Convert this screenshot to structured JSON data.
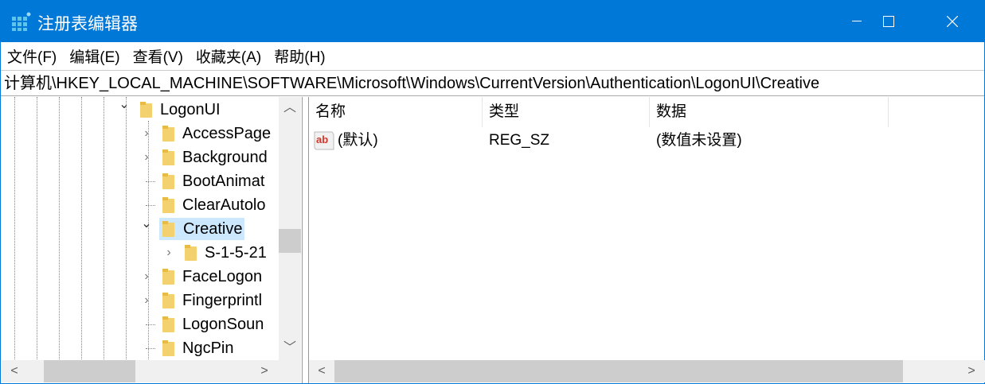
{
  "window": {
    "title": "注册表编辑器",
    "accent": "#0078d7"
  },
  "menu": [
    "文件(F)",
    "编辑(E)",
    "查看(V)",
    "收藏夹(A)",
    "帮助(H)"
  ],
  "address": "计算机\\HKEY_LOCAL_MACHINE\\SOFTWARE\\Microsoft\\Windows\\CurrentVersion\\Authentication\\LogonUI\\Creative",
  "tree": [
    {
      "label": "LogonUI",
      "expander": "expanded",
      "level": 0
    },
    {
      "label": "AccessPage",
      "expander": "collapsed",
      "level": 1
    },
    {
      "label": "Background",
      "expander": "collapsed",
      "level": 1
    },
    {
      "label": "BootAnimat",
      "expander": "none",
      "level": 1
    },
    {
      "label": "ClearAutolo",
      "expander": "none",
      "level": 1
    },
    {
      "label": "Creative",
      "expander": "expanded",
      "level": 1,
      "selected": true
    },
    {
      "label": "S-1-5-21",
      "expander": "collapsed",
      "level": 2
    },
    {
      "label": "FaceLogon",
      "expander": "collapsed",
      "level": 1
    },
    {
      "label": "Fingerprintl",
      "expander": "collapsed",
      "level": 1
    },
    {
      "label": "LogonSoun",
      "expander": "none",
      "level": 1
    },
    {
      "label": "NgcPin",
      "expander": "none",
      "level": 1
    }
  ],
  "values": {
    "columns": [
      "名称",
      "类型",
      "数据"
    ],
    "rows": [
      {
        "name": "(默认)",
        "type": "REG_SZ",
        "data": "(数值未设置)",
        "icon": "string-value-icon"
      }
    ]
  }
}
